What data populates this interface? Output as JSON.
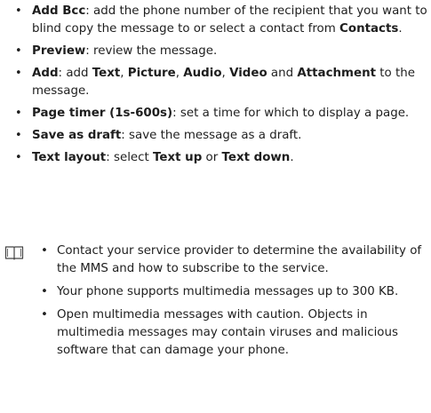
{
  "bullets": [
    {
      "parts": [
        {
          "t": "Add Bcc",
          "b": true
        },
        {
          "t": ": add the phone number of the recipient that you want to blind copy the message to or select a contact from ",
          "b": false
        },
        {
          "t": "Contacts",
          "b": true
        },
        {
          "t": ".",
          "b": false
        }
      ]
    },
    {
      "parts": [
        {
          "t": "Preview",
          "b": true
        },
        {
          "t": ": review the message.",
          "b": false
        }
      ]
    },
    {
      "parts": [
        {
          "t": "Add",
          "b": true
        },
        {
          "t": ": add ",
          "b": false
        },
        {
          "t": "Text",
          "b": true
        },
        {
          "t": ", ",
          "b": false
        },
        {
          "t": "Picture",
          "b": true
        },
        {
          "t": ", ",
          "b": false
        },
        {
          "t": "Audio",
          "b": true
        },
        {
          "t": ", ",
          "b": false
        },
        {
          "t": "Video",
          "b": true
        },
        {
          "t": " and ",
          "b": false
        },
        {
          "t": "Attachment",
          "b": true
        },
        {
          "t": " to the message.",
          "b": false
        }
      ]
    },
    {
      "parts": [
        {
          "t": "Page timer (1s-600s)",
          "b": true
        },
        {
          "t": ": set a time for which to display a page.",
          "b": false
        }
      ]
    },
    {
      "parts": [
        {
          "t": "Save as draft",
          "b": true
        },
        {
          "t": ": save the message as a draft.",
          "b": false
        }
      ]
    },
    {
      "parts": [
        {
          "t": "Text layout",
          "b": true
        },
        {
          "t": ": select ",
          "b": false
        },
        {
          "t": "Text up",
          "b": true
        },
        {
          "t": " or ",
          "b": false
        },
        {
          "t": "Text down",
          "b": true
        },
        {
          "t": ".",
          "b": false
        }
      ]
    }
  ],
  "note": {
    "icon": "book-icon",
    "items": [
      "Contact your service provider to determine the availability of the MMS and how to subscribe to the service.",
      "Your phone supports multimedia messages up to 300 KB.",
      "Open multimedia messages with caution. Objects in multimedia messages may contain viruses and malicious software that can damage your phone."
    ]
  }
}
